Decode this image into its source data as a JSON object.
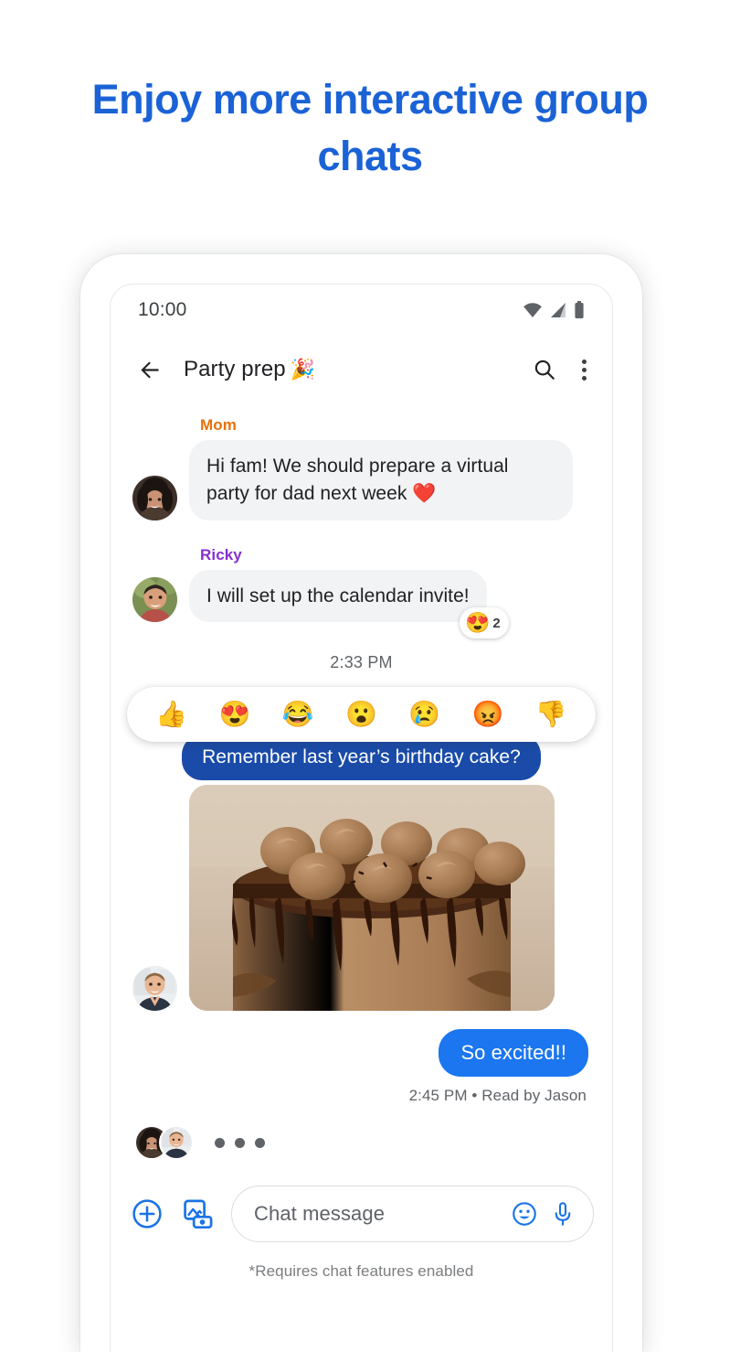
{
  "headline": "Enjoy more interactive group chats",
  "colors": {
    "headline_blue": "#1a62d6",
    "bubble_dark_blue": "#1a4ba8",
    "bubble_blue": "#1b76f0",
    "bubble_incoming_gray": "#f1f3f4",
    "sender_mom": "#e8710a",
    "sender_ricky": "#8430ce",
    "icon_blue": "#1a73e8"
  },
  "status_bar": {
    "time": "10:00",
    "icons": [
      "wifi-icon",
      "signal-icon",
      "battery-icon"
    ]
  },
  "app_bar": {
    "back_icon": "back-arrow-icon",
    "title": "Party prep",
    "title_emoji": "🎉",
    "search_icon": "search-icon",
    "more_icon": "more-vertical-icon"
  },
  "messages": [
    {
      "sender": "Mom",
      "sender_color": "#e8710a",
      "text": "Hi fam! We should prepare a virtual party for dad next week ❤️",
      "avatar": "avatar-mom"
    },
    {
      "sender": "Ricky",
      "sender_color": "#8430ce",
      "text": "I will set up the calendar invite!",
      "avatar": "avatar-ricky",
      "reaction": {
        "emoji": "😍",
        "count": "2"
      }
    }
  ],
  "time_divider": "2:33 PM",
  "emoji_picker": {
    "emojis": [
      "👍",
      "😍",
      "😂",
      "😮",
      "😢",
      "😡",
      "👎"
    ],
    "names": [
      "thumbs-up",
      "heart-eyes",
      "joy",
      "surprised",
      "crying",
      "angry",
      "thumbs-down"
    ]
  },
  "outgoing_dark": "Remember last year’s birthday cake?",
  "image_message": {
    "alt": "chocolate-birthday-cake",
    "avatar": "avatar-jason"
  },
  "outgoing_blue": "So excited!!",
  "read_receipt": "2:45 PM • Read by Jason",
  "typing": {
    "avatars": [
      "avatar-mom",
      "avatar-jason"
    ],
    "dots": 3
  },
  "compose": {
    "plus_icon": "plus-circle-icon",
    "gallery_icon": "gallery-camera-icon",
    "placeholder": "Chat message",
    "emoji_icon": "emoji-smile-icon",
    "mic_icon": "microphone-icon"
  },
  "footnote": "*Requires chat features enabled"
}
